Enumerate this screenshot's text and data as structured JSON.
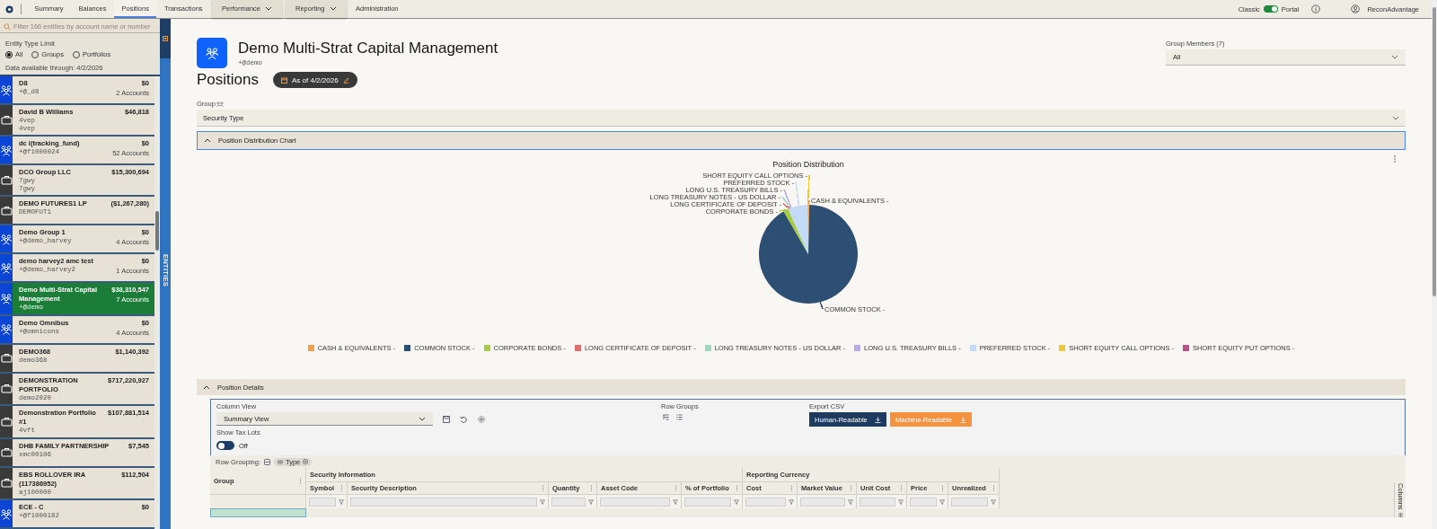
{
  "nav": {
    "tabs": [
      {
        "label": "Summary",
        "selected": false,
        "dropdown": false
      },
      {
        "label": "Balances",
        "selected": false,
        "dropdown": false
      },
      {
        "label": "Positions",
        "selected": true,
        "dropdown": false
      },
      {
        "label": "Transactions",
        "selected": false,
        "dropdown": false
      },
      {
        "label": "Performance",
        "selected": false,
        "dropdown": true
      },
      {
        "label": "Reporting",
        "selected": false,
        "dropdown": true
      },
      {
        "label": "Administration",
        "selected": false,
        "dropdown": false
      }
    ]
  },
  "mode_switch": {
    "left_label": "Classic",
    "right_label": "Portal",
    "on": true
  },
  "user": {
    "name": "ReconAdvantage"
  },
  "sidebar": {
    "filter_placeholder": "Filter 166 entities by account name or number",
    "type_limit": {
      "label": "Entity Type Limit",
      "options": [
        {
          "label": "All",
          "selected": true
        },
        {
          "label": "Groups",
          "selected": false
        },
        {
          "label": "Portfolios",
          "selected": false
        }
      ]
    },
    "data_note": "Data available through: 4/2/2026",
    "entities": [
      {
        "kind": "group",
        "name": "D8",
        "codes": [
          "+@_d8"
        ],
        "value": "$0",
        "accounts": "2 Accounts",
        "selected": false
      },
      {
        "kind": "portfolio",
        "name": "David B Williams",
        "codes": [
          "4vep",
          "4vep"
        ],
        "value": "$46,818",
        "selected": false
      },
      {
        "kind": "group",
        "name": "dc l(tracking_fund)",
        "codes": [
          "+@f1000024"
        ],
        "value": "$0",
        "accounts": "52 Accounts",
        "selected": false
      },
      {
        "kind": "portfolio",
        "name": "DCO Group LLC",
        "codes": [
          "7gwy",
          "7gwy"
        ],
        "value": "$15,300,694",
        "selected": false
      },
      {
        "kind": "portfolio",
        "name": "DEMO FUTURES1 LP",
        "codes": [
          "DEMOFUT1"
        ],
        "value": "($1,267,280)",
        "selected": false
      },
      {
        "kind": "group",
        "name": "Demo Group 1",
        "codes": [
          "+@demo_harvey"
        ],
        "value": "$0",
        "accounts": "4 Accounts",
        "selected": false
      },
      {
        "kind": "group",
        "name": "demo harvey2 amc test",
        "codes": [
          "+@demo_harvey2"
        ],
        "value": "$0",
        "accounts": "1 Accounts",
        "selected": false
      },
      {
        "kind": "group",
        "name": "Demo Multi-Strat Capital Management",
        "codes": [
          "+@demo"
        ],
        "value": "$38,310,547",
        "accounts": "7 Accounts",
        "selected": true
      },
      {
        "kind": "group",
        "name": "Demo Omnibus",
        "codes": [
          "+@omnicons"
        ],
        "value": "$0",
        "accounts": "4 Accounts",
        "selected": false
      },
      {
        "kind": "portfolio",
        "name": "DEMO368",
        "codes": [
          "demo368"
        ],
        "value": "$1,140,392",
        "selected": false
      },
      {
        "kind": "portfolio",
        "name": "DEMONSTRATION PORTFOLIO",
        "codes": [
          "demo2020"
        ],
        "value": "$717,220,927",
        "selected": false
      },
      {
        "kind": "portfolio",
        "name": "Demonstration Portfolio #1",
        "codes": [
          "4vft"
        ],
        "value": "$107,881,514",
        "selected": false
      },
      {
        "kind": "portfolio",
        "name": "DHB FAMILY PARTNERSHIP",
        "codes": [
          "xmc00106"
        ],
        "value": "$7,545",
        "selected": false
      },
      {
        "kind": "portfolio",
        "name": "EBS ROLLOVER IRA (117386952)",
        "codes": [
          "aj100000"
        ],
        "value": "$112,504",
        "selected": false
      },
      {
        "kind": "group",
        "name": "ECE - C",
        "codes": [
          "+@f1000182"
        ],
        "value": "$0",
        "selected": false
      }
    ]
  },
  "side_tab": {
    "label": "ENTITIES"
  },
  "header": {
    "title": "Demo Multi-Strat Capital Management",
    "handle": "+@demo",
    "page": "Positions",
    "as_of": "As of 4/2/2026"
  },
  "group_members": {
    "label": "Group Members (7)",
    "value": "All"
  },
  "group_by": {
    "label": "Group",
    "value": "Security Type"
  },
  "chart_section": {
    "title": "Position Distribution Chart",
    "expanded": true,
    "chart_title": "Position Distribution",
    "slice_labels": [
      {
        "label": "SHORT EQUITY CALL OPTIONS -",
        "color": "#f2c832"
      },
      {
        "label": "PREFERRED STOCK -",
        "color": "#c3dbf7"
      },
      {
        "label": "LONG U.S. TREASURY BILLS -",
        "color": "#b9a8ee"
      },
      {
        "label": "LONG TREASURY NOTES - US DOLLAR -",
        "color": "#9dd9c0"
      },
      {
        "label": "CASH & EQUIVALENTS -",
        "color": "#f4a048"
      },
      {
        "label": "LONG CERTIFICATE OF DEPOSIT -",
        "color": "#e06c6c"
      },
      {
        "label": "CORPORATE BONDS -",
        "color": "#a8cc3c"
      },
      {
        "label": "COMMON STOCK -",
        "color": "#2c4f73"
      }
    ],
    "legend": [
      {
        "label": "CASH & EQUIVALENTS -",
        "color": "#f4a048"
      },
      {
        "label": "COMMON STOCK -",
        "color": "#2c4f73"
      },
      {
        "label": "CORPORATE BONDS -",
        "color": "#a8cc3c"
      },
      {
        "label": "LONG CERTIFICATE OF DEPOSIT -",
        "color": "#e06c6c"
      },
      {
        "label": "LONG TREASURY NOTES - US DOLLAR -",
        "color": "#9dd9c0"
      },
      {
        "label": "LONG U.S. TREASURY BILLS -",
        "color": "#b9a8ee"
      },
      {
        "label": "PREFERRED STOCK -",
        "color": "#c3dbf7"
      },
      {
        "label": "SHORT EQUITY CALL OPTIONS -",
        "color": "#f2c832"
      },
      {
        "label": "SHORT EQUITY PUT OPTIONS -",
        "color": "#c0508a"
      }
    ]
  },
  "details_section": {
    "title": "Position Details",
    "expanded": true,
    "column_view": {
      "label": "Column View",
      "value": "Summary View"
    },
    "row_groups_label": "Row Groups",
    "export": {
      "label": "Export CSV",
      "buttons": [
        {
          "label": "Human-Readable",
          "kind": "primary"
        },
        {
          "label": "Machine-Readable",
          "kind": "accent"
        }
      ]
    },
    "tax_lots": {
      "label": "Show Tax Lots",
      "on": false,
      "state_label": "Off"
    },
    "row_grouping": {
      "label": "Row Grouping:",
      "chips": [
        "Type"
      ]
    },
    "table": {
      "group_column": "Group",
      "column_groups": [
        {
          "label": "Security Information",
          "columns": [
            "Symbol",
            "Security Description",
            "Quantity",
            "Asset Code",
            "% of Portfolio"
          ]
        },
        {
          "label": "Reporting Currency",
          "columns": [
            "Cost",
            "Market Value",
            "Unit Cost",
            "Price",
            "Unrealized"
          ]
        }
      ]
    },
    "columns_tab": "Columns"
  }
}
